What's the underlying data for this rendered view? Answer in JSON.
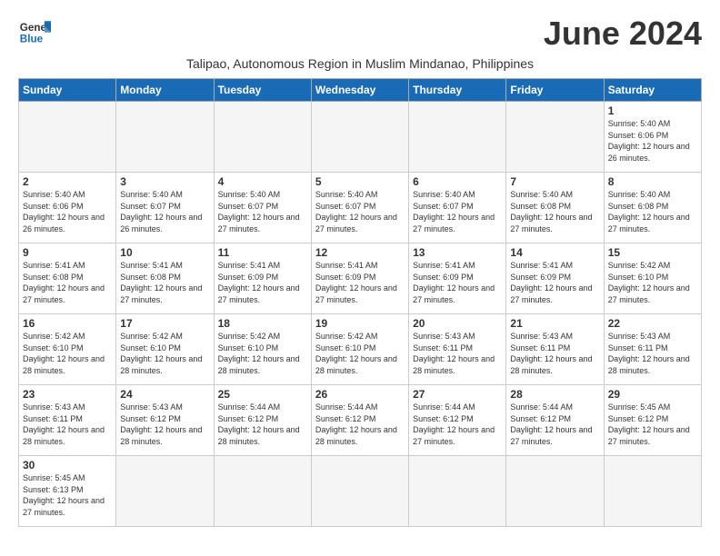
{
  "header": {
    "logo_general": "General",
    "logo_blue": "Blue",
    "month_year": "June 2024",
    "subtitle": "Talipao, Autonomous Region in Muslim Mindanao, Philippines"
  },
  "days_of_week": [
    "Sunday",
    "Monday",
    "Tuesday",
    "Wednesday",
    "Thursday",
    "Friday",
    "Saturday"
  ],
  "weeks": [
    [
      {
        "day": "",
        "empty": true
      },
      {
        "day": "",
        "empty": true
      },
      {
        "day": "",
        "empty": true
      },
      {
        "day": "",
        "empty": true
      },
      {
        "day": "",
        "empty": true
      },
      {
        "day": "",
        "empty": true
      },
      {
        "day": "1",
        "sunrise": "5:40 AM",
        "sunset": "6:06 PM",
        "daylight": "12 hours and 26 minutes."
      }
    ],
    [
      {
        "day": "2",
        "sunrise": "5:40 AM",
        "sunset": "6:06 PM",
        "daylight": "12 hours and 26 minutes."
      },
      {
        "day": "3",
        "sunrise": "5:40 AM",
        "sunset": "6:07 PM",
        "daylight": "12 hours and 26 minutes."
      },
      {
        "day": "4",
        "sunrise": "5:40 AM",
        "sunset": "6:07 PM",
        "daylight": "12 hours and 27 minutes."
      },
      {
        "day": "5",
        "sunrise": "5:40 AM",
        "sunset": "6:07 PM",
        "daylight": "12 hours and 27 minutes."
      },
      {
        "day": "6",
        "sunrise": "5:40 AM",
        "sunset": "6:07 PM",
        "daylight": "12 hours and 27 minutes."
      },
      {
        "day": "7",
        "sunrise": "5:40 AM",
        "sunset": "6:08 PM",
        "daylight": "12 hours and 27 minutes."
      },
      {
        "day": "8",
        "sunrise": "5:40 AM",
        "sunset": "6:08 PM",
        "daylight": "12 hours and 27 minutes."
      }
    ],
    [
      {
        "day": "9",
        "sunrise": "5:41 AM",
        "sunset": "6:08 PM",
        "daylight": "12 hours and 27 minutes."
      },
      {
        "day": "10",
        "sunrise": "5:41 AM",
        "sunset": "6:08 PM",
        "daylight": "12 hours and 27 minutes."
      },
      {
        "day": "11",
        "sunrise": "5:41 AM",
        "sunset": "6:09 PM",
        "daylight": "12 hours and 27 minutes."
      },
      {
        "day": "12",
        "sunrise": "5:41 AM",
        "sunset": "6:09 PM",
        "daylight": "12 hours and 27 minutes."
      },
      {
        "day": "13",
        "sunrise": "5:41 AM",
        "sunset": "6:09 PM",
        "daylight": "12 hours and 27 minutes."
      },
      {
        "day": "14",
        "sunrise": "5:41 AM",
        "sunset": "6:09 PM",
        "daylight": "12 hours and 27 minutes."
      },
      {
        "day": "15",
        "sunrise": "5:42 AM",
        "sunset": "6:10 PM",
        "daylight": "12 hours and 27 minutes."
      }
    ],
    [
      {
        "day": "16",
        "sunrise": "5:42 AM",
        "sunset": "6:10 PM",
        "daylight": "12 hours and 28 minutes."
      },
      {
        "day": "17",
        "sunrise": "5:42 AM",
        "sunset": "6:10 PM",
        "daylight": "12 hours and 28 minutes."
      },
      {
        "day": "18",
        "sunrise": "5:42 AM",
        "sunset": "6:10 PM",
        "daylight": "12 hours and 28 minutes."
      },
      {
        "day": "19",
        "sunrise": "5:42 AM",
        "sunset": "6:10 PM",
        "daylight": "12 hours and 28 minutes."
      },
      {
        "day": "20",
        "sunrise": "5:43 AM",
        "sunset": "6:11 PM",
        "daylight": "12 hours and 28 minutes."
      },
      {
        "day": "21",
        "sunrise": "5:43 AM",
        "sunset": "6:11 PM",
        "daylight": "12 hours and 28 minutes."
      },
      {
        "day": "22",
        "sunrise": "5:43 AM",
        "sunset": "6:11 PM",
        "daylight": "12 hours and 28 minutes."
      }
    ],
    [
      {
        "day": "23",
        "sunrise": "5:43 AM",
        "sunset": "6:11 PM",
        "daylight": "12 hours and 28 minutes."
      },
      {
        "day": "24",
        "sunrise": "5:43 AM",
        "sunset": "6:12 PM",
        "daylight": "12 hours and 28 minutes."
      },
      {
        "day": "25",
        "sunrise": "5:44 AM",
        "sunset": "6:12 PM",
        "daylight": "12 hours and 28 minutes."
      },
      {
        "day": "26",
        "sunrise": "5:44 AM",
        "sunset": "6:12 PM",
        "daylight": "12 hours and 28 minutes."
      },
      {
        "day": "27",
        "sunrise": "5:44 AM",
        "sunset": "6:12 PM",
        "daylight": "12 hours and 27 minutes."
      },
      {
        "day": "28",
        "sunrise": "5:44 AM",
        "sunset": "6:12 PM",
        "daylight": "12 hours and 27 minutes."
      },
      {
        "day": "29",
        "sunrise": "5:45 AM",
        "sunset": "6:12 PM",
        "daylight": "12 hours and 27 minutes."
      }
    ],
    [
      {
        "day": "30",
        "sunrise": "5:45 AM",
        "sunset": "6:13 PM",
        "daylight": "12 hours and 27 minutes."
      },
      {
        "day": "",
        "empty": true
      },
      {
        "day": "",
        "empty": true
      },
      {
        "day": "",
        "empty": true
      },
      {
        "day": "",
        "empty": true
      },
      {
        "day": "",
        "empty": true
      },
      {
        "day": "",
        "empty": true
      }
    ]
  ],
  "colors": {
    "header_bg": "#1a6bb5",
    "header_text": "#ffffff",
    "border": "#cccccc",
    "empty_bg": "#f5f5f5"
  }
}
